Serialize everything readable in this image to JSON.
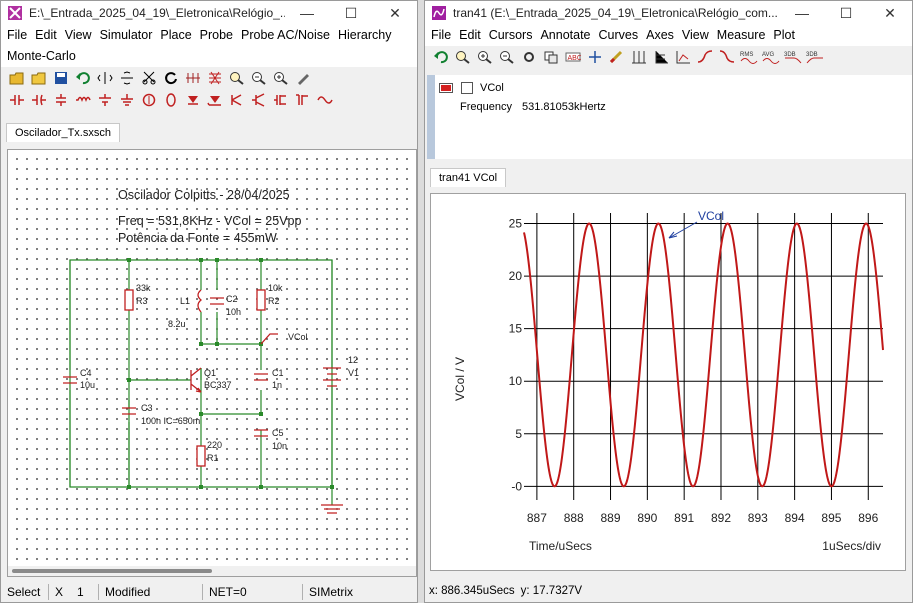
{
  "left_window": {
    "title": "E:\\_Entrada_2025_04_19\\_Eletronica\\Relógio_...",
    "menus": [
      "File",
      "Edit",
      "View",
      "Simulator",
      "Place",
      "Probe",
      "Probe AC/Noise",
      "Hierarchy",
      "Monte-Carlo"
    ],
    "tab": "Oscilador_Tx.sxsch",
    "status": {
      "mode": "Select",
      "x_label": "X",
      "x_value": "1",
      "modified": "Modified",
      "net": "NET=0",
      "app": "SIMetrix"
    }
  },
  "schematic": {
    "title": "Oscilador Colpitts - 28/04/2025",
    "line2": "Freq = 531,8KHz - VCol = 25Vpp",
    "line3": "Potência da Fonte = 455mW",
    "components": {
      "R3_value": "33k",
      "R3_name": "R3",
      "L1_name": "L1",
      "L1_value": "8.2u",
      "C2_name": "C2",
      "C2_value": "10n",
      "R2_value": "10k",
      "R2_name": "R2",
      "probe_label": "VCol",
      "C4_name": "C4",
      "C4_value": "10u",
      "Q1_name": "Q1",
      "Q1_value": "BC337",
      "C1_name": "C1",
      "C1_value": "1n",
      "V1_value": "12",
      "V1_name": "V1",
      "C3_name": "C3",
      "C3_value": "100n IC=650m",
      "R1_value": "220",
      "R1_name": "R1",
      "C5_name": "C5",
      "C5_value": "10n"
    }
  },
  "right_window": {
    "title": "tran41 (E:\\_Entrada_2025_04_19\\_Eletronica\\Relógio_com...",
    "menus": [
      "File",
      "Edit",
      "Cursors",
      "Annotate",
      "Curves",
      "Axes",
      "View",
      "Measure",
      "Plot"
    ],
    "legend": {
      "trace_name": "VCol",
      "measure_label": "Frequency",
      "measure_value": "531.81053kHertz",
      "trace_color": "#d42020"
    },
    "tab": "tran41 VCol",
    "status": {
      "x_readout": "x: 886.345uSecs",
      "y_readout": "y: 17.7327V"
    }
  },
  "chart_data": {
    "type": "line",
    "series": [
      {
        "name": "VCol",
        "color": "#c01818",
        "amplitude_pp": 25,
        "offset": 12.5,
        "frequency_khz": 531.81
      }
    ],
    "curve_label": "VCol",
    "xlabel": "Time/uSecs",
    "ylabel": "VCol / V",
    "x_div_label": "1uSecs/div",
    "xlim": [
      886.65,
      896.4
    ],
    "ylim": [
      -1.3,
      26
    ],
    "xticks": [
      887,
      888,
      889,
      890,
      891,
      892,
      893,
      894,
      895,
      896
    ],
    "yticks": [
      0,
      5,
      10,
      15,
      20,
      25
    ],
    "ytick_labels": [
      "-0",
      "5",
      "10",
      "15",
      "20",
      "25"
    ],
    "grid": true
  }
}
